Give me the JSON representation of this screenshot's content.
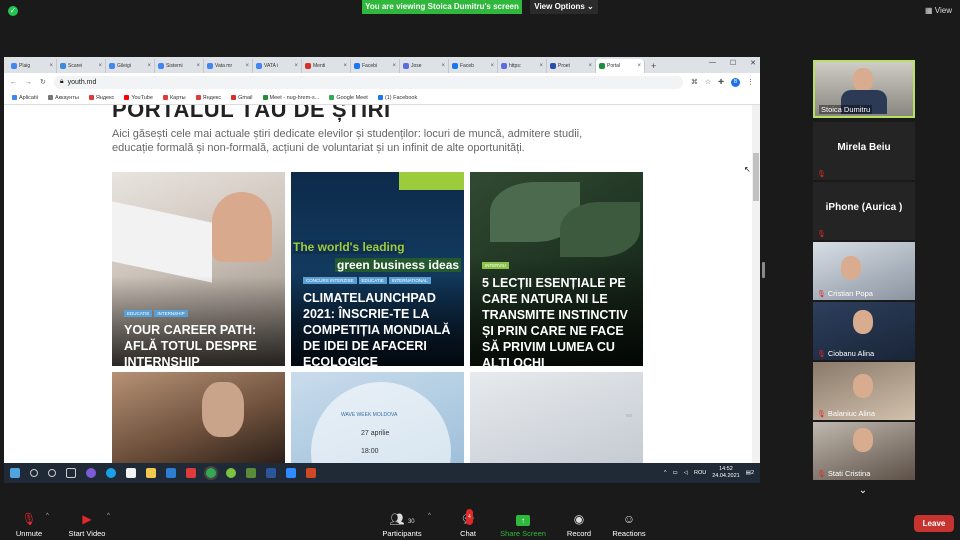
{
  "zoom": {
    "share_banner": "You are viewing Stoica Dumitru's screen",
    "view_options": "View Options ⌄",
    "view": "View"
  },
  "browser": {
    "tabs": [
      "Plaig",
      "Scarei",
      "Gileigi",
      "Sisterni",
      "Vata mr",
      "VATA i",
      "Menti",
      "Facebi",
      "Jose",
      "Faceb",
      "https:",
      "Proet",
      "Portal"
    ],
    "url": "youth.md",
    "profile": "B",
    "bookmarks": [
      "Aplicatii",
      "Аккаунты",
      "Яндекс",
      "YouTube",
      "Карты",
      "Яндекс",
      "Gmail",
      "Meet - nug-hrem-s...",
      "Google Meet",
      "(1) Facebook"
    ],
    "bookmark_colors": [
      "#4285f4",
      "#777777",
      "#e03a3a",
      "#ff0000",
      "#e03a3a",
      "#e03a3a",
      "#d93025",
      "#1e8e3e",
      "#34a853",
      "#1877f2"
    ]
  },
  "page": {
    "title": "PORTALUL TĂU DE ȘTIRI",
    "description": "Aici găsești cele mai actuale știri dedicate elevilor și studenților: locuri de muncă, admitere studii, educație formală și non-formală, acțiuni de voluntariat și un infinit de alte oportunități.",
    "cards": [
      {
        "tags": [
          "Educatie",
          "Internship"
        ],
        "title": "Your career path: află totul despre internship"
      },
      {
        "tags": [
          "Concurs Interzise",
          "Educatie",
          "International"
        ],
        "title": "ClimateLaunchpad 2021: înscrie-te la competiția mondială de idei de afaceri ecologice",
        "banner1": "The world's leading",
        "banner2": "green business ideas"
      },
      {
        "tags": [
          "Interviu"
        ],
        "title": "5 lecții esențiale pe care natura ni le transmite instinctiv și prin care ne face să privim lumea cu alți ochi"
      }
    ],
    "wave_week": "WAVE WEEK MOLDOVA",
    "wave_date": "27 aprilie",
    "wave_time": "18:00",
    "faint_text": "ws"
  },
  "taskbar": {
    "lang": "ROU",
    "time": "14:52",
    "date": "24.04.2021",
    "notif": "2"
  },
  "participants": [
    {
      "name": "Stoica Dumitru"
    },
    {
      "name": "Mirela Beiu"
    },
    {
      "name": "iPhone (Aurica )"
    },
    {
      "name": "Cristian Popa"
    },
    {
      "name": "Ciobanu Alina"
    },
    {
      "name": "Balaniuc Alina"
    },
    {
      "name": "Stati Cristina"
    }
  ],
  "toolbar": {
    "unmute": "Unmute",
    "start_video": "Start Video",
    "participants": "Participants",
    "participants_count": "30",
    "chat": "Chat",
    "chat_badge": "4",
    "share_screen": "Share Screen",
    "record": "Record",
    "reactions": "Reactions",
    "leave": "Leave"
  }
}
